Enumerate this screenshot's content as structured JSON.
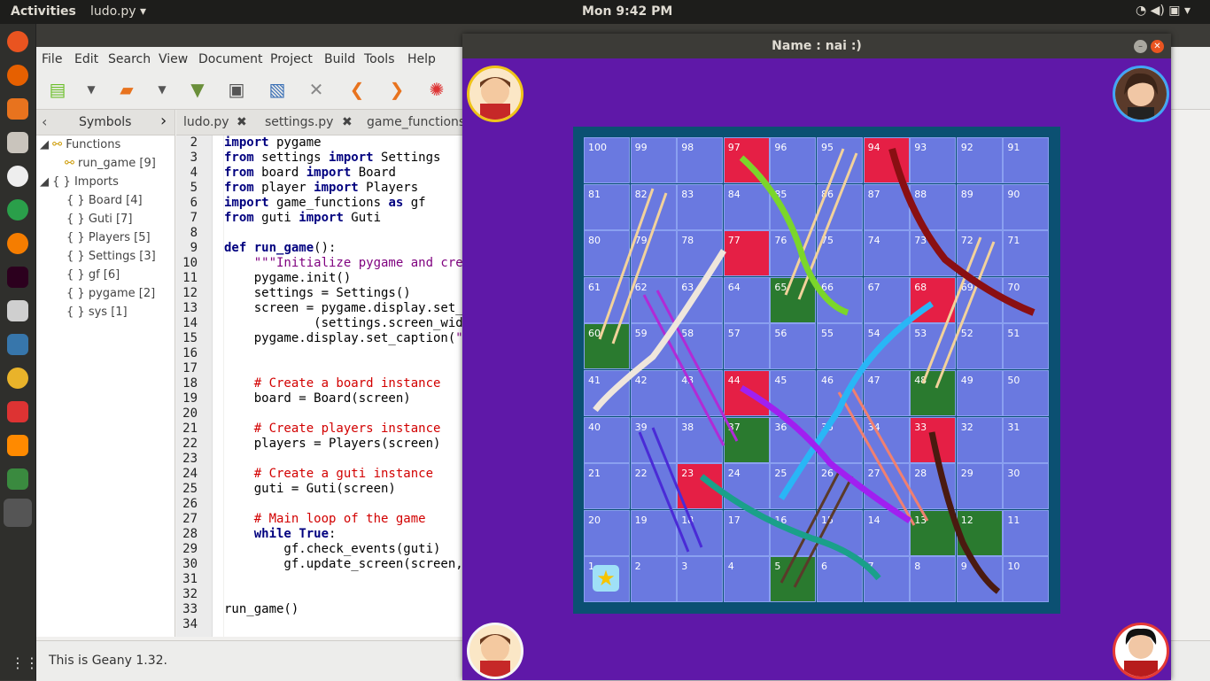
{
  "top_panel": {
    "activities": "Activities",
    "app_menu": "ludo.py ▾",
    "clock": "Mon  9:42 PM",
    "tray": "◔  ◀)  ▣ ▾"
  },
  "menu": [
    "File",
    "Edit",
    "Search",
    "View",
    "Document",
    "Project",
    "Build",
    "Tools",
    "Help"
  ],
  "sidebar": {
    "tab": "Symbols",
    "functions_label": "Functions",
    "functions": [
      "run_game [9]"
    ],
    "imports_label": "Imports",
    "imports": [
      "Board [4]",
      "Guti [7]",
      "Players [5]",
      "Settings [3]",
      "gf [6]",
      "pygame [2]",
      "sys [1]"
    ]
  },
  "tabs": [
    "ludo.py",
    "settings.py",
    "game_functions"
  ],
  "gutter": [
    "2",
    "3",
    "4",
    "5",
    "6",
    "7",
    "8",
    "9",
    "10",
    "11",
    "12",
    "13",
    "14",
    "15",
    "16",
    "17",
    "18",
    "19",
    "20",
    "21",
    "22",
    "23",
    "24",
    "25",
    "26",
    "27",
    "28",
    "29",
    "30",
    "31",
    "32",
    "33",
    "34"
  ],
  "code_lines": [
    [
      "kw:import",
      "t: pygame"
    ],
    [
      "kw:from",
      "t: settings ",
      "kw:import",
      "t: Settings"
    ],
    [
      "kw:from",
      "t: board ",
      "kw:import",
      "t: Board"
    ],
    [
      "kw:from",
      "t: player ",
      "kw:import",
      "t: Players"
    ],
    [
      "kw:import",
      "t: game_functions ",
      "kw:as",
      "t: gf"
    ],
    [
      "kw:from",
      "t: guti ",
      "kw:import",
      "t: Guti"
    ],
    [],
    [
      "kw:def",
      "t: ",
      "fn:run_game",
      "t:():"
    ],
    [
      "t:    ",
      "st:\"\"\"Initialize pygame and creat"
    ],
    [
      "t:    pygame.init()"
    ],
    [
      "t:    settings = Settings()"
    ],
    [
      "t:    screen = pygame.display.set_mo"
    ],
    [
      "t:            (settings.screen_width"
    ],
    [
      "t:    pygame.display.set_caption(",
      "st:\"Na"
    ],
    [],
    [],
    [
      "cm:    # Create a board instance"
    ],
    [
      "t:    board = Board(screen)"
    ],
    [],
    [
      "cm:    # Create players instance"
    ],
    [
      "t:    players = Players(screen)"
    ],
    [],
    [
      "cm:    # Create a guti instance"
    ],
    [
      "t:    guti = Guti(screen)"
    ],
    [],
    [
      "cm:    # Main loop of the game"
    ],
    [
      "t:    ",
      "kw:while",
      "t: ",
      "kw:True",
      "t::"
    ],
    [
      "t:        gf.check_events(guti)"
    ],
    [
      "t:        gf.update_screen(screen, s"
    ],
    [],
    [],
    [
      "t:run_game()"
    ],
    []
  ],
  "status": "This is Geany 1.32.",
  "game": {
    "title": "Name : nai :)",
    "red_cells": [
      97,
      94,
      77,
      68,
      44,
      33,
      23
    ],
    "green_cells": [
      65,
      60,
      48,
      37,
      13,
      12,
      5
    ],
    "colors": {
      "cell": "#6a79e0",
      "red": "#e51f45",
      "green": "#2a7a2f",
      "window": "#5f18a8"
    }
  }
}
